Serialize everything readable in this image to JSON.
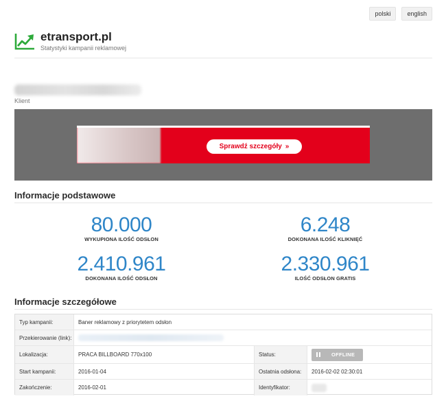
{
  "lang": {
    "polish": "polski",
    "english": "english"
  },
  "brand": {
    "title": "etransport.pl",
    "subtitle": "Statystyki kampanii reklamowej",
    "icon": "trend-up-icon",
    "icon_color": "#2daa3a"
  },
  "client": {
    "label": "Klient"
  },
  "banner": {
    "cta_label": "Sprawdź szczegóły",
    "cta_arrow": "»",
    "brand_color": "#e3001b"
  },
  "basic": {
    "title": "Informacje podstawowe",
    "stats": [
      {
        "value": "80.000",
        "label": "WYKUPIONA ILOŚĆ ODSŁON"
      },
      {
        "value": "6.248",
        "label": "DOKONANA ILOŚĆ KLIKNIĘĆ"
      },
      {
        "value": "2.410.961",
        "label": "DOKONANA ILOŚĆ ODSŁON"
      },
      {
        "value": "2.330.961",
        "label": "ILOŚĆ ODSŁON GRATIS"
      }
    ],
    "value_color": "#2f86c8"
  },
  "details": {
    "title": "Informacje szczegółowe",
    "type_label": "Typ kampanii:",
    "type_value": "Baner reklamowy z priorytetem odsłon",
    "redirect_label": "Przekierowanie (link):",
    "location_label": "Lokalizacja:",
    "location_value": "PRACA BILLBOARD 770x100",
    "status_label": "Status:",
    "status_value": "OFFLINE",
    "start_label": "Start kampanii:",
    "start_value": "2016-01-04",
    "last_view_label": "Ostatnia odsłona:",
    "last_view_value": "2016-02-02 02:30:01",
    "end_label": "Zakończenie:",
    "end_value": "2016-02-01",
    "id_label": "Identyfikator:"
  }
}
